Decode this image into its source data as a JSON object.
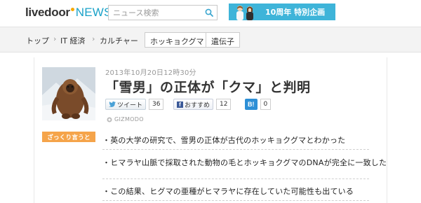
{
  "header": {
    "logo_main": "livedoor",
    "logo_news": "NEWS",
    "search_placeholder": "ニュース検索",
    "banner_text": "10周年 特別企画"
  },
  "breadcrumb": {
    "items": [
      "トップ",
      "IT 経済",
      "カルチャー"
    ],
    "tags": [
      "ホッキョクグマ",
      "遺伝子"
    ]
  },
  "article": {
    "date": "2013年10月20日12時30分",
    "title": "「雪男」の正体が「クマ」と判明",
    "tweet_label": "ツイート",
    "tweet_count": "36",
    "fb_label": "おすすめ",
    "fb_count": "12",
    "hatena_label": "B!",
    "hatena_count": "0",
    "source": "GIZMODO",
    "summary_label": "ざっくり言うと",
    "summary": [
      "英の大学の研究で、雪男の正体が古代のホッキョクグマとわかった",
      "ヒマラヤ山脈で採取された動物の毛とホッキョクグマのDNAが完全に一致した",
      "この結果、ヒグマの亜種がヒマラヤに存在していた可能性も出ている"
    ]
  },
  "colors": {
    "news_blue": "#1aa2c8",
    "banner_blue": "#3eb4d9",
    "summary_orange": "#f5a44a"
  }
}
